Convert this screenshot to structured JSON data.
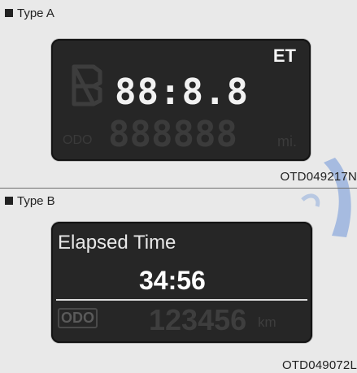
{
  "type_a": {
    "label": "Type A",
    "display": {
      "time": "88:8.8",
      "indicator": "ET",
      "odo_label": "ODO",
      "odo_digits": "888888",
      "odo_unit": "mi."
    },
    "code": "OTD049217N"
  },
  "type_b": {
    "label": "Type B",
    "display": {
      "title": "Elapsed Time",
      "time": "34:56",
      "odo_label": "ODO",
      "odo_value": "123456",
      "odo_unit": "km"
    },
    "code": "OTD049072L"
  },
  "colors": {
    "lcd_background": "#262626",
    "lcd_text": "#f2f2f2",
    "lcd_dim": "#3b3b3b",
    "watermark": "#6f95d8"
  }
}
